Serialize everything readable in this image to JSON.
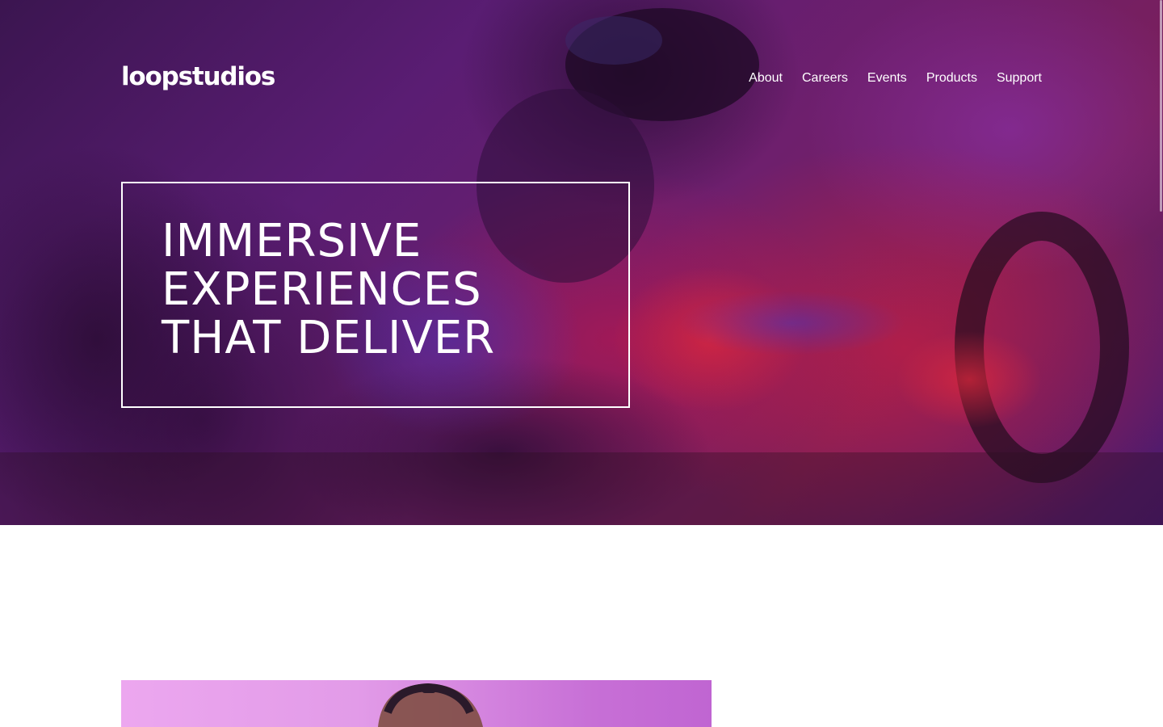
{
  "header": {
    "logo": "loopstudios",
    "nav": [
      {
        "label": "About"
      },
      {
        "label": "Careers"
      },
      {
        "label": "Events"
      },
      {
        "label": "Products"
      },
      {
        "label": "Support"
      }
    ]
  },
  "hero": {
    "title": "IMMERSIVE EXPERIENCES THAT DELIVER",
    "background_colors": [
      "#3b1550",
      "#6e1f6d",
      "#7a1f5a"
    ]
  },
  "scrollbar": {
    "position_fraction": 0.0
  }
}
